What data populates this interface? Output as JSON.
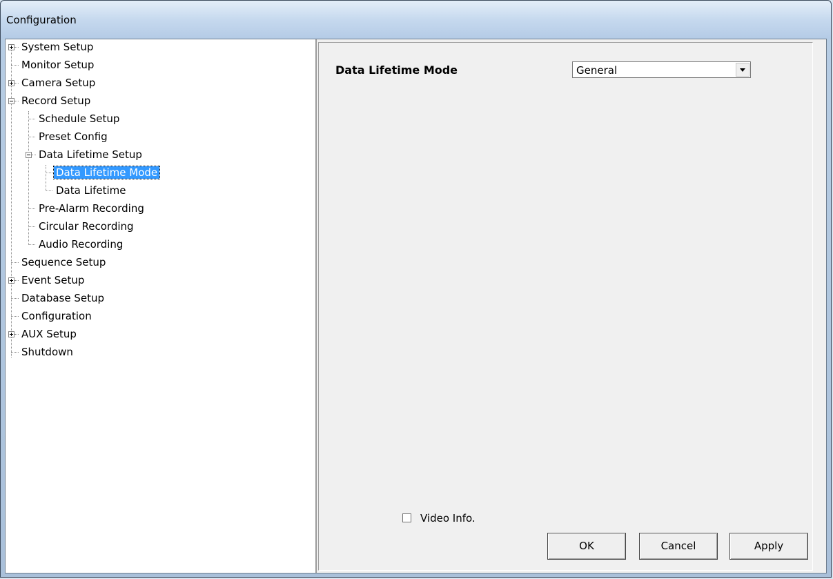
{
  "window": {
    "title": "Configuration"
  },
  "tree": {
    "items": [
      {
        "label": "System Setup"
      },
      {
        "label": "Monitor Setup"
      },
      {
        "label": "Camera Setup"
      },
      {
        "label": "Record Setup"
      },
      {
        "label": "Schedule Setup"
      },
      {
        "label": "Preset Config"
      },
      {
        "label": "Data Lifetime Setup"
      },
      {
        "label": "Data Lifetime Mode"
      },
      {
        "label": "Data Lifetime"
      },
      {
        "label": "Pre-Alarm Recording"
      },
      {
        "label": "Circular Recording"
      },
      {
        "label": "Audio Recording"
      },
      {
        "label": "Sequence Setup"
      },
      {
        "label": "Event Setup"
      },
      {
        "label": "Database Setup"
      },
      {
        "label": "Configuration"
      },
      {
        "label": "AUX Setup"
      },
      {
        "label": "Shutdown"
      }
    ]
  },
  "panel": {
    "field_label": "Data Lifetime Mode",
    "field_value": "General",
    "checkbox_label": "Video Info."
  },
  "buttons": {
    "ok": "OK",
    "cancel": "Cancel",
    "apply": "Apply"
  },
  "colors": {
    "selection": "#3399ff"
  }
}
